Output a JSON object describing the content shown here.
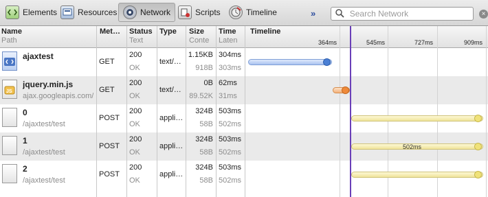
{
  "toolbar": {
    "panels": [
      {
        "label": "Elements",
        "icon": "elements-icon"
      },
      {
        "label": "Resources",
        "icon": "resources-icon"
      },
      {
        "label": "Network",
        "icon": "network-icon"
      },
      {
        "label": "Scripts",
        "icon": "scripts-icon"
      },
      {
        "label": "Timeline",
        "icon": "timeline-icon"
      }
    ],
    "active_panel": "Network",
    "more": "»",
    "search_placeholder": "Search Network",
    "close_glyph": "×"
  },
  "columns": {
    "name": {
      "title": "Name",
      "sub": "Path"
    },
    "method": {
      "title": "Met…"
    },
    "status": {
      "title": "Status",
      "sub": "Text"
    },
    "type": {
      "title": "Type"
    },
    "size": {
      "title": "Size",
      "sub": "Conte"
    },
    "time": {
      "title": "Time",
      "sub": "Laten"
    },
    "timeline": {
      "title": "Timeline"
    }
  },
  "timeline_ticks": [
    "364ms",
    "545ms",
    "727ms",
    "909ms"
  ],
  "requests": [
    {
      "name": "ajaxtest",
      "path": "",
      "method": "GET",
      "status": "200",
      "status_text": "OK",
      "type": "text/…",
      "size": "1.15KB",
      "content": "918B",
      "time": "304ms",
      "latency": "303ms",
      "bar_label": ""
    },
    {
      "name": "jquery.min.js",
      "path": "ajax.googleapis.com/",
      "method": "GET",
      "status": "200",
      "status_text": "OK",
      "type": "text/…",
      "size": "0B",
      "content": "89.52K",
      "time": "62ms",
      "latency": "31ms",
      "bar_label": ""
    },
    {
      "name": "0",
      "path": "/ajaxtest/test",
      "method": "POST",
      "status": "200",
      "status_text": "OK",
      "type": "appli…",
      "size": "324B",
      "content": "58B",
      "time": "503ms",
      "latency": "502ms",
      "bar_label": ""
    },
    {
      "name": "1",
      "path": "/ajaxtest/test",
      "method": "POST",
      "status": "200",
      "status_text": "OK",
      "type": "appli…",
      "size": "324B",
      "content": "58B",
      "time": "503ms",
      "latency": "502ms",
      "bar_label": "502ms"
    },
    {
      "name": "2",
      "path": "/ajaxtest/test",
      "method": "POST",
      "status": "200",
      "status_text": "OK",
      "type": "appli…",
      "size": "324B",
      "content": "58B",
      "time": "503ms",
      "latency": "502ms",
      "bar_label": ""
    }
  ],
  "colors": {
    "marker": "#6a3fb8",
    "toolbar_link": "#2e4e9e"
  }
}
